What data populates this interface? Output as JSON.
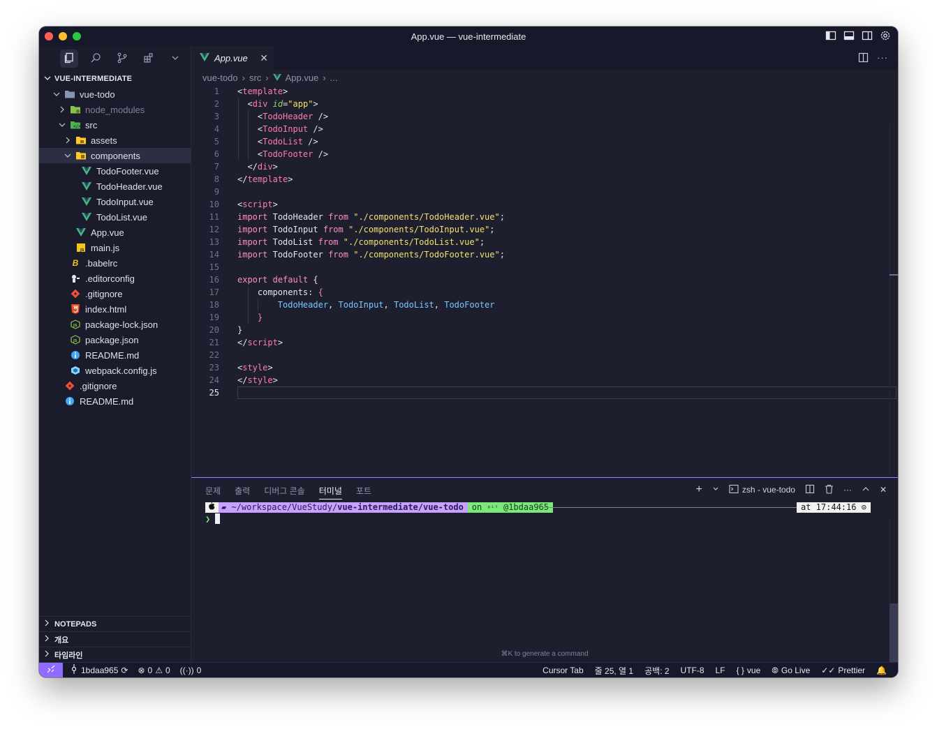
{
  "window": {
    "title": "App.vue — vue-intermediate"
  },
  "sidebar": {
    "explorer_title": "VUE-INTERMEDIATE",
    "tree": [
      {
        "label": "vue-todo",
        "icon": "folder-open-icon"
      },
      {
        "label": "node_modules",
        "icon": "node-folder-icon"
      },
      {
        "label": "src",
        "icon": "src-folder-icon"
      },
      {
        "label": "assets",
        "icon": "assets-folder-icon"
      },
      {
        "label": "components",
        "icon": "components-folder-icon"
      },
      {
        "label": "TodoFooter.vue",
        "icon": "vue-icon"
      },
      {
        "label": "TodoHeader.vue",
        "icon": "vue-icon"
      },
      {
        "label": "TodoInput.vue",
        "icon": "vue-icon"
      },
      {
        "label": "TodoList.vue",
        "icon": "vue-icon"
      },
      {
        "label": "App.vue",
        "icon": "vue-icon"
      },
      {
        "label": "main.js",
        "icon": "js-icon"
      },
      {
        "label": ".babelrc",
        "icon": "babel-icon"
      },
      {
        "label": ".editorconfig",
        "icon": "editorconfig-icon"
      },
      {
        "label": ".gitignore",
        "icon": "git-icon"
      },
      {
        "label": "index.html",
        "icon": "html-icon"
      },
      {
        "label": "package-lock.json",
        "icon": "npm-json-icon"
      },
      {
        "label": "package.json",
        "icon": "npm-json-icon"
      },
      {
        "label": "README.md",
        "icon": "info-icon"
      },
      {
        "label": "webpack.config.js",
        "icon": "webpack-icon"
      },
      {
        "label": ".gitignore",
        "icon": "git-icon"
      },
      {
        "label": "README.md",
        "icon": "info-icon"
      }
    ],
    "sections": [
      "NOTEPADS",
      "개요",
      "타임라인"
    ]
  },
  "editor": {
    "tab_label": "App.vue",
    "breadcrumb": [
      "vue-todo",
      "src",
      "App.vue",
      "..."
    ],
    "line_numbers": [
      "1",
      "2",
      "3",
      "4",
      "5",
      "6",
      "7",
      "8",
      "9",
      "10",
      "11",
      "12",
      "13",
      "14",
      "15",
      "16",
      "17",
      "18",
      "19",
      "20",
      "21",
      "22",
      "23",
      "24",
      "25"
    ],
    "code": {
      "l1_tag": "template",
      "l2_tag": "div",
      "l2_attr": "id",
      "l2_val": "\"app\"",
      "l3": "TodoHeader",
      "l4": "TodoInput",
      "l5": "TodoList",
      "l6": "TodoFooter",
      "l7": "div",
      "l8": "template",
      "l10": "script",
      "imports": [
        {
          "name": "TodoHeader",
          "path": "\"./components/TodoHeader.vue\""
        },
        {
          "name": "TodoInput",
          "path": "\"./components/TodoInput.vue\""
        },
        {
          "name": "TodoList",
          "path": "\"./components/TodoList.vue\""
        },
        {
          "name": "TodoFooter",
          "path": "\"./components/TodoFooter.vue\""
        }
      ],
      "kw_import": "import",
      "kw_from": "from",
      "kw_export": "export",
      "kw_default": "default",
      "components_key": "components",
      "components_list": [
        "TodoHeader",
        "TodoInput",
        "TodoList",
        "TodoFooter"
      ],
      "l21": "script",
      "l23": "style",
      "l24": "style"
    }
  },
  "panel": {
    "tabs": [
      "문제",
      "출력",
      "디버그 콘솔",
      "터미널",
      "포트"
    ],
    "terminal_name": "zsh - vue-todo",
    "prompt_path_prefix": "~/workspace/VueStudy/",
    "prompt_path_bold": "vue-intermediate/vue-todo",
    "prompt_git_on": "on",
    "prompt_git_branch": "@1bdaa965",
    "prompt_time": "at 17:44:16",
    "prompt_char": "❯",
    "hint": "⌘K to generate a command"
  },
  "statusbar": {
    "branch": "1bdaa965",
    "errors": "0",
    "warnings": "0",
    "ports": "0",
    "cursor_tab": "Cursor Tab",
    "position": "줄 25, 열 1",
    "spaces": "공백: 2",
    "encoding": "UTF-8",
    "eol": "LF",
    "language": "vue",
    "go_live": "Go Live",
    "prettier": "Prettier"
  },
  "colors": {
    "accent": "#8f6bff",
    "vue_green": "#41b883",
    "tag": "#ff7ab8",
    "string": "#f5e06b",
    "component": "#7cc7ff"
  }
}
